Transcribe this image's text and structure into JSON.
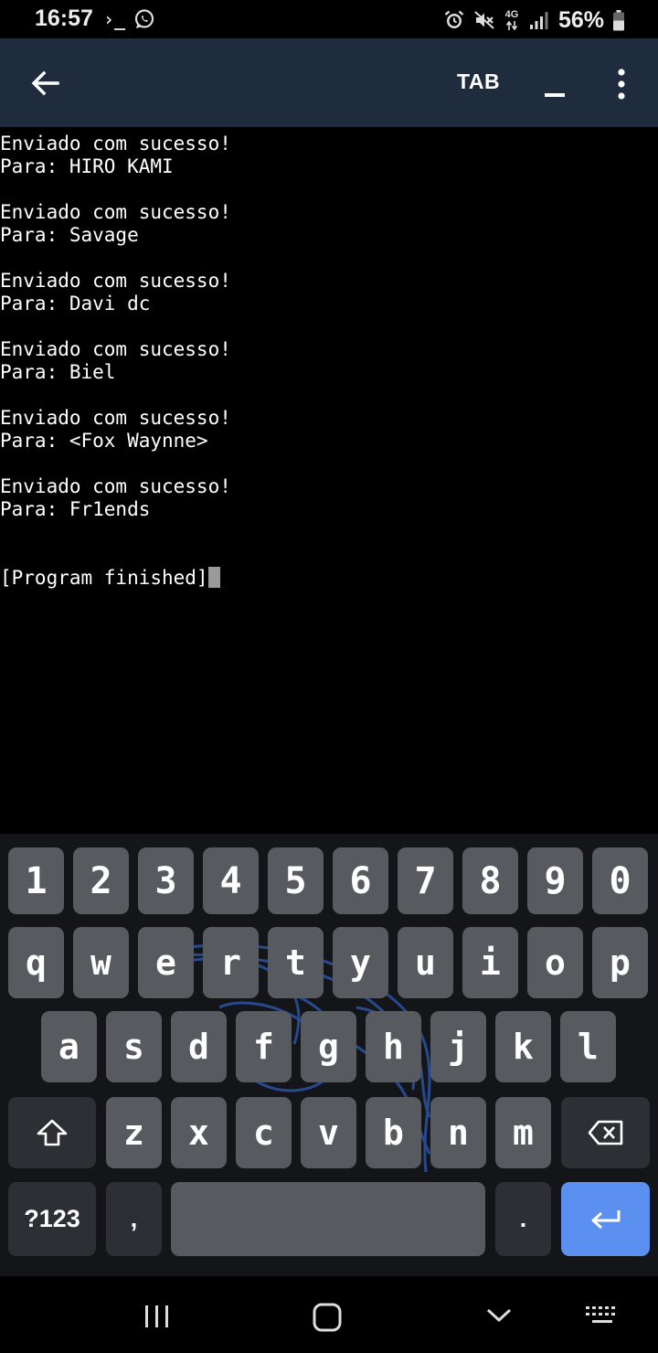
{
  "status_bar": {
    "time": "16:57",
    "terminal_icon_text": "›_",
    "network": "4G",
    "battery_percent": "56%",
    "left_icons": [
      "terminal-icon",
      "whatsapp-icon"
    ],
    "right_icons": [
      "alarm-icon",
      "mute-icon",
      "data-4g-icon",
      "signal-icon",
      "battery-icon"
    ]
  },
  "toolbar": {
    "back_icon": "arrow-left-icon",
    "tab_label": "TAB",
    "minimize_icon": "underscore-icon",
    "more_icon": "more-vertical-icon",
    "background_color": "#1f2c3e"
  },
  "terminal": {
    "lines": [
      "Enviado com sucesso!",
      "Para: HIRO KAMI",
      "",
      "Enviado com sucesso!",
      "Para: Savage",
      "",
      "Enviado com sucesso!",
      "Para: Davi dc",
      "",
      "Enviado com sucesso!",
      "Para: Biel",
      "",
      "Enviado com sucesso!",
      "Para: <Fox Waynne>",
      "",
      "Enviado com sucesso!",
      "Para: Fr1ends",
      "",
      "",
      "[Program finished]"
    ],
    "cursor_visible": true
  },
  "keyboard": {
    "number_row": [
      "1",
      "2",
      "3",
      "4",
      "5",
      "6",
      "7",
      "8",
      "9",
      "0"
    ],
    "row1": [
      "q",
      "w",
      "e",
      "r",
      "t",
      "y",
      "u",
      "i",
      "o",
      "p"
    ],
    "row2": [
      "a",
      "s",
      "d",
      "f",
      "g",
      "h",
      "j",
      "k",
      "l"
    ],
    "row3": [
      "z",
      "x",
      "c",
      "v",
      "b",
      "n",
      "m"
    ],
    "shift_icon": "shift-icon",
    "backspace_icon": "backspace-icon",
    "symbols_label": "?123",
    "comma_label": ",",
    "period_label": ".",
    "enter_icon": "enter-icon",
    "key_color": "#575a5e",
    "enter_color": "#5b8ff0",
    "background_logo": "kali-dragon-logo"
  },
  "nav_bar": {
    "icons": [
      "recent-apps-icon",
      "home-icon",
      "back-chevron-icon",
      "keyboard-switch-icon"
    ]
  }
}
